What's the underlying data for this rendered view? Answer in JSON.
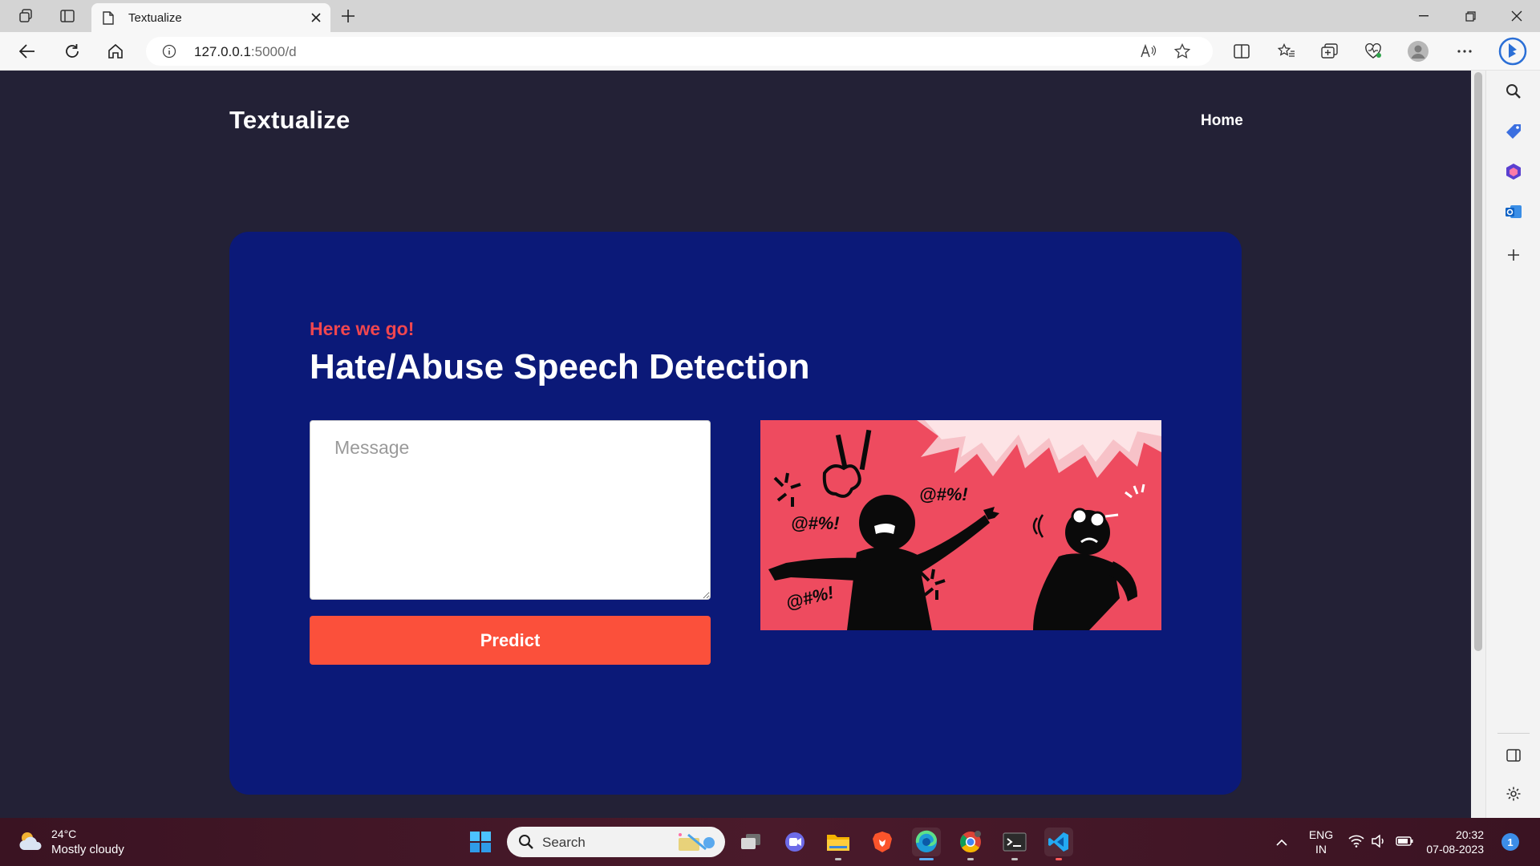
{
  "browser": {
    "tab_title": "Textualize",
    "address_host": "127.0.0.1",
    "address_rest": ":5000/d"
  },
  "page": {
    "brand": "Textualize",
    "nav": {
      "home": "Home"
    },
    "card": {
      "eyebrow": "Here we go!",
      "heading": "Hate/Abuse Speech Detection",
      "message_placeholder": "Message",
      "predict_label": "Predict"
    },
    "illustration": {
      "symbols_1": "@#%!",
      "symbols_2": "@#%!",
      "symbols_3": "@#%!"
    }
  },
  "taskbar": {
    "weather_temp": "24°C",
    "weather_desc": "Mostly cloudy",
    "search_label": "Search",
    "lang_line1": "ENG",
    "lang_line2": "IN",
    "time": "20:32",
    "date": "07-08-2023",
    "notification_count": "1"
  },
  "colors": {
    "page_bg": "#232136",
    "card_bg": "#0b1978",
    "accent_red": "#f0464f",
    "button_bg": "#fb503b",
    "illustration_bg": "#ee4b5f"
  }
}
